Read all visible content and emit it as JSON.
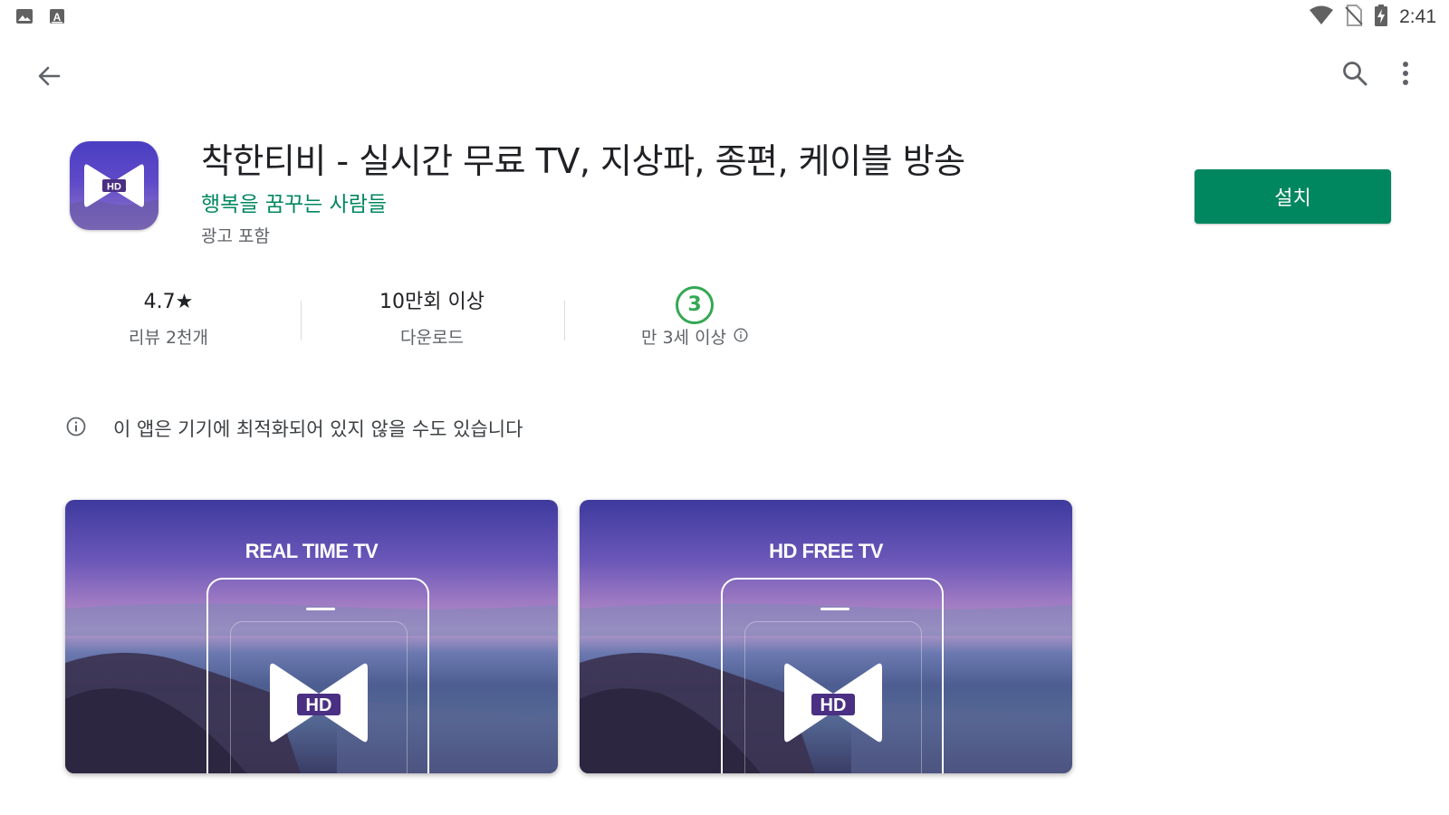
{
  "status_bar": {
    "time": "2:41",
    "left_icons": [
      "image-icon",
      "keyboard-a-icon"
    ],
    "right_icons": [
      "wifi-icon",
      "no-sim-icon",
      "battery-charging-icon"
    ]
  },
  "toolbar": {
    "back_icon": "back-arrow-icon",
    "search_icon": "search-icon",
    "more_icon": "more-vert-icon"
  },
  "app": {
    "title": "착한티비 - 실시간 무료 TV, 지상파, 종편, 케이블 방송",
    "developer": "행복을 꿈꾸는 사람들",
    "ads_note": "광고 포함",
    "icon_badge": "HD",
    "install_label": "설치"
  },
  "stats": {
    "rating": "4.7★",
    "reviews": "리뷰 2천개",
    "downloads": "10만회 이상",
    "downloads_label": "다운로드",
    "age_rating": "3",
    "age_label": "만 3세 이상"
  },
  "notice": {
    "text": "이 앱은 기기에 최적화되어 있지 않을 수도 있습니다"
  },
  "screenshots": [
    {
      "caption": "REAL TIME TV",
      "badge": "HD"
    },
    {
      "caption": "HD FREE TV",
      "badge": "HD"
    }
  ],
  "colors": {
    "accent_green": "#01875f",
    "age_green": "#34a853",
    "app_icon_purple": "#4b3ec2"
  }
}
